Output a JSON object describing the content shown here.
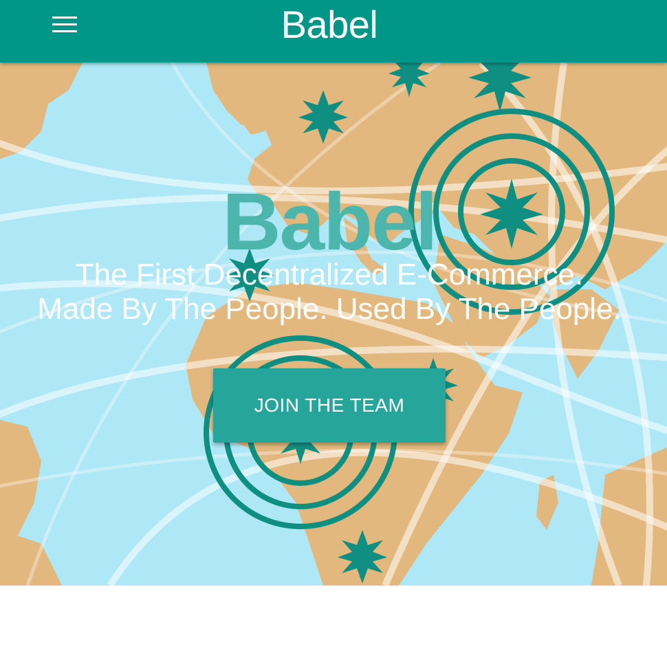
{
  "header": {
    "menu_icon": "hamburger-menu-icon",
    "brand": "Babel"
  },
  "hero": {
    "title": "Babel",
    "tagline_line1": "The First Decentralized E-Commerce.",
    "tagline_line2": "Made By The People. Used By The People.",
    "cta_label": "JOIN THE TEAM",
    "background_image": "world-map-network-illustration"
  },
  "colors": {
    "primary": "#009688",
    "button": "#26a69a",
    "hero_title": "#4db6ac",
    "ocean": "#a9e6f5",
    "land": "#e2b476",
    "signal": "#00897b"
  }
}
